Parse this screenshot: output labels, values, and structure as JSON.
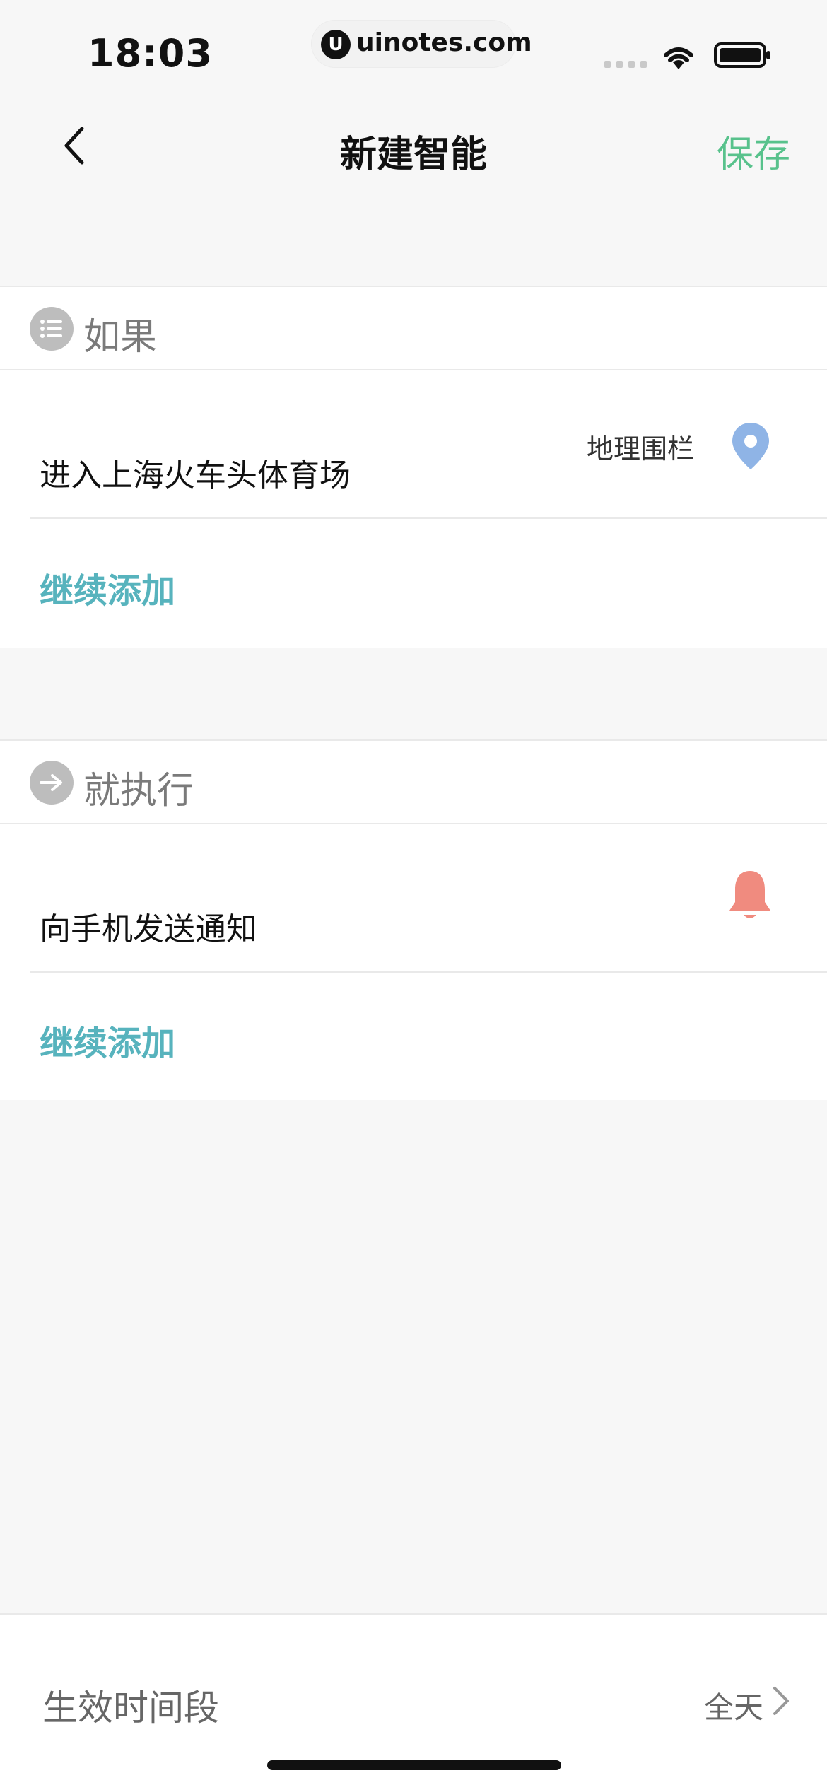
{
  "status_bar": {
    "time": "18:03",
    "watermark_text": "uinotes.com",
    "watermark_logo": "U",
    "icons": [
      "signal-dots-icon",
      "wifi-icon",
      "battery-icon"
    ]
  },
  "nav": {
    "title": "新建智能",
    "save_label": "保存",
    "back_icon": "chevron-left-icon"
  },
  "if_section": {
    "title": "如果",
    "icon": "list-icon",
    "row": {
      "label": "进入上海火车头体育场",
      "tag": "地理围栏",
      "icon": "location-pin-icon"
    },
    "add_label": "继续添加"
  },
  "then_section": {
    "title": "就执行",
    "icon": "arrow-right-icon",
    "row": {
      "label": "向手机发送通知",
      "icon": "bell-icon"
    },
    "add_label": "继续添加"
  },
  "effective_time": {
    "label": "生效时间段",
    "value": "全天",
    "icon": "chevron-right-icon"
  },
  "colors": {
    "accent_green": "#58c28c",
    "link_teal": "#57b3bd",
    "pin_blue": "#8fb4e6",
    "bell_coral": "#f08b7f"
  }
}
